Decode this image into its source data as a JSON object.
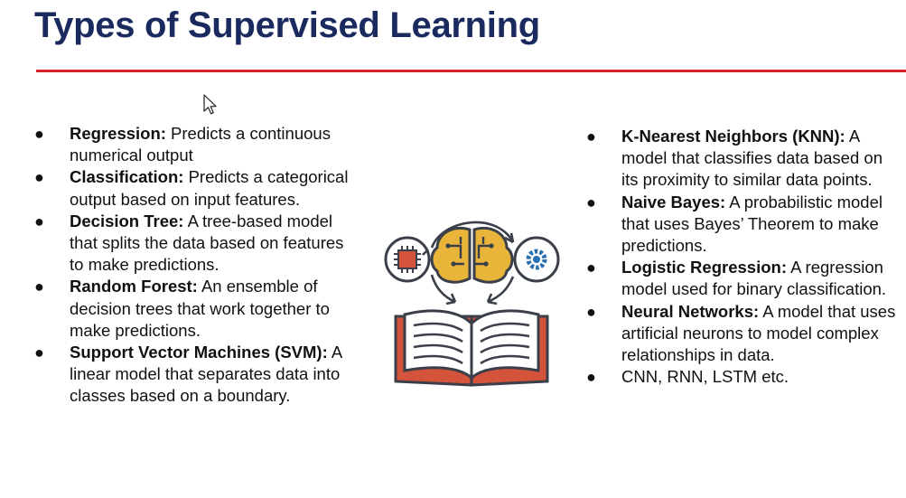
{
  "slide": {
    "title": "Types of Supervised Learning"
  },
  "left_items": [
    {
      "term": "Regression:",
      "desc": " Predicts a continuous numerical output"
    },
    {
      "term": "Classification:",
      "desc": " Predicts a categorical output based on input features."
    },
    {
      "term": "Decision Tree:",
      "desc": " A tree-based model that splits the data based on features to make predictions."
    },
    {
      "term": "Random Forest:",
      "desc": " An ensemble of decision trees that work together to make predictions."
    },
    {
      "term": "Support Vector Machines (SVM):",
      "desc": " A linear model that separates data into classes based on a boundary."
    }
  ],
  "right_items": [
    {
      "term": "K-Nearest Neighbors (KNN):",
      "desc": " A model that classifies data based on its proximity to similar data points."
    },
    {
      "term": "Naive Bayes:",
      "desc": " A probabilistic model that uses Bayes’ Theorem to make predictions."
    },
    {
      "term": "Logistic Regression:",
      "desc": " A regression model used for binary classification."
    },
    {
      "term": "Neural Networks:",
      "desc": " A model that uses artificial neurons to model complex relationships in data."
    },
    {
      "term": "",
      "desc": "CNN, RNN, LSTM etc."
    }
  ],
  "bullet_char": "●",
  "icons": {
    "cursor": "mouse-pointer-icon",
    "illustration": "book-brain-learning-icon"
  },
  "colors": {
    "title": "#1b2a5e",
    "rule": "#d8222a",
    "icon_orange": "#d4533b",
    "icon_gold": "#e8b53a",
    "icon_blue": "#2a6fb0",
    "icon_outline": "#3a3f4a"
  }
}
